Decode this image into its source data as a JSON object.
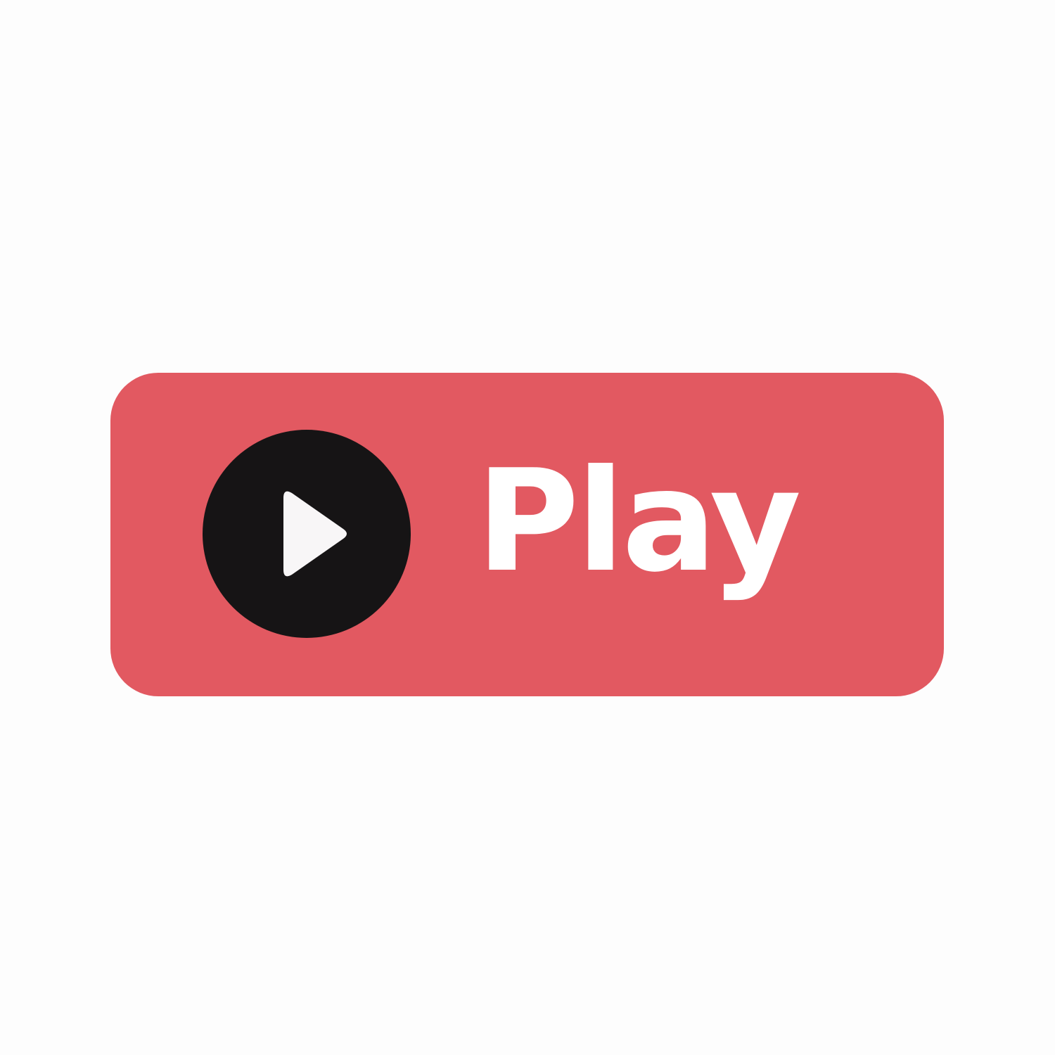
{
  "button": {
    "label": "Play",
    "icon": "play-icon"
  },
  "colors": {
    "background": "#fdfdfd",
    "button_background": "#e25961",
    "icon_circle": "#161415",
    "icon_triangle": "#f8f6f7",
    "label_text": "#ffffff"
  }
}
